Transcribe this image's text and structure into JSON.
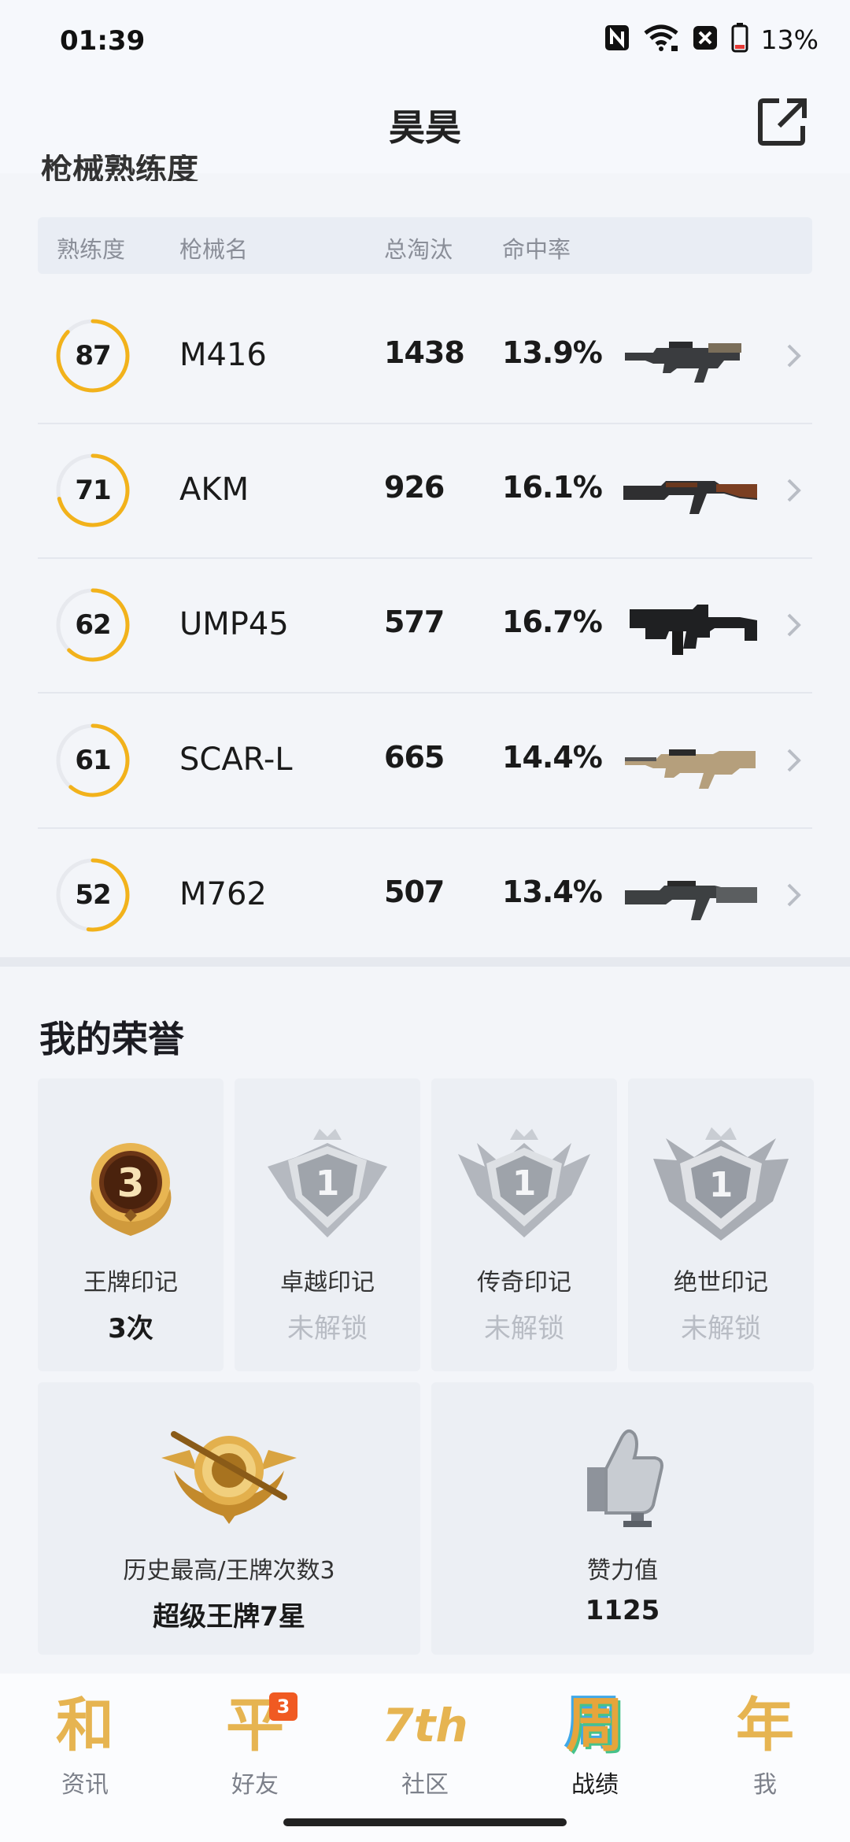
{
  "status_bar": {
    "time": "01:39",
    "battery": "13%"
  },
  "header": {
    "title": "昊昊"
  },
  "peek_section_title": "枪械熟练度",
  "table_headers": [
    "熟练度",
    "枪械名",
    "总淘汰",
    "命中率"
  ],
  "weapons": [
    {
      "proficiency": "87",
      "progress": 0.87,
      "name": "M416",
      "kills": "1438",
      "hit_rate": "13.9%"
    },
    {
      "proficiency": "71",
      "progress": 0.71,
      "name": "AKM",
      "kills": "926",
      "hit_rate": "16.1%"
    },
    {
      "proficiency": "62",
      "progress": 0.62,
      "name": "UMP45",
      "kills": "577",
      "hit_rate": "16.7%"
    },
    {
      "proficiency": "61",
      "progress": 0.61,
      "name": "SCAR-L",
      "kills": "665",
      "hit_rate": "14.4%"
    },
    {
      "proficiency": "52",
      "progress": 0.52,
      "name": "M762",
      "kills": "507",
      "hit_rate": "13.4%"
    }
  ],
  "honor": {
    "title": "我的荣誉",
    "marks": [
      {
        "label": "王牌印记",
        "value": "3次",
        "badge_number": "3",
        "locked": false
      },
      {
        "label": "卓越印记",
        "value": "未解锁",
        "badge_number": "1",
        "locked": true
      },
      {
        "label": "传奇印记",
        "value": "未解锁",
        "badge_number": "1",
        "locked": true
      },
      {
        "label": "绝世印记",
        "value": "未解锁",
        "badge_number": "1",
        "locked": true
      }
    ],
    "history_label": "历史最高/王牌次数3",
    "history_value": "超级王牌7星",
    "likes_label": "赞力值",
    "likes_value": "1125"
  },
  "nav": {
    "items": [
      {
        "glyph": "和",
        "label": "资讯",
        "badge": ""
      },
      {
        "glyph": "平",
        "label": "好友",
        "badge": "3"
      },
      {
        "glyph": "7th",
        "label": "社区",
        "badge": ""
      },
      {
        "glyph": "周",
        "label": "战绩",
        "badge": ""
      },
      {
        "glyph": "年",
        "label": "我",
        "badge": ""
      }
    ],
    "active_index": 3
  },
  "colors": {
    "accent": "#f2b21b",
    "ring_track": "#e7e9ee",
    "nav_gold": "#e8b54a",
    "badge": "#f05a22"
  }
}
